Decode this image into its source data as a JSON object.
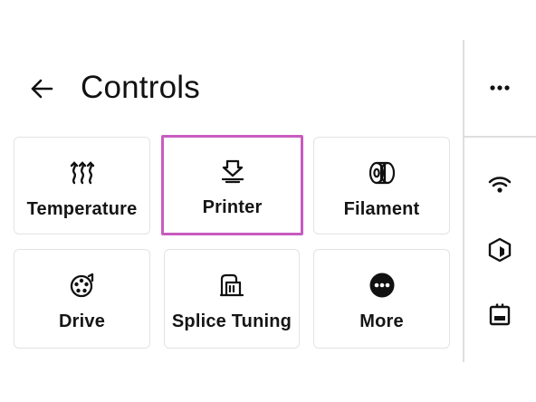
{
  "header": {
    "title": "Controls",
    "back_icon": "arrow-left-icon"
  },
  "tiles": [
    {
      "label": "Temperature",
      "icon": "heat-waves-icon",
      "selected": false
    },
    {
      "label": "Printer",
      "icon": "printer-nozzle-icon",
      "selected": true
    },
    {
      "label": "Filament",
      "icon": "filament-spool-icon",
      "selected": false
    },
    {
      "label": "Drive",
      "icon": "drive-gear-icon",
      "selected": false
    },
    {
      "label": "Splice Tuning",
      "icon": "splice-tuning-icon",
      "selected": false
    },
    {
      "label": "More",
      "icon": "more-circle-icon",
      "selected": false
    }
  ],
  "sidebar": {
    "items": [
      {
        "icon": "more-horizontal-icon"
      },
      {
        "icon": "wifi-icon"
      },
      {
        "icon": "cube-icon"
      },
      {
        "icon": "device-icon"
      }
    ]
  },
  "colors": {
    "selection_border": "#c85cbf",
    "tile_border": "#e3e3e3",
    "text": "#151515"
  }
}
